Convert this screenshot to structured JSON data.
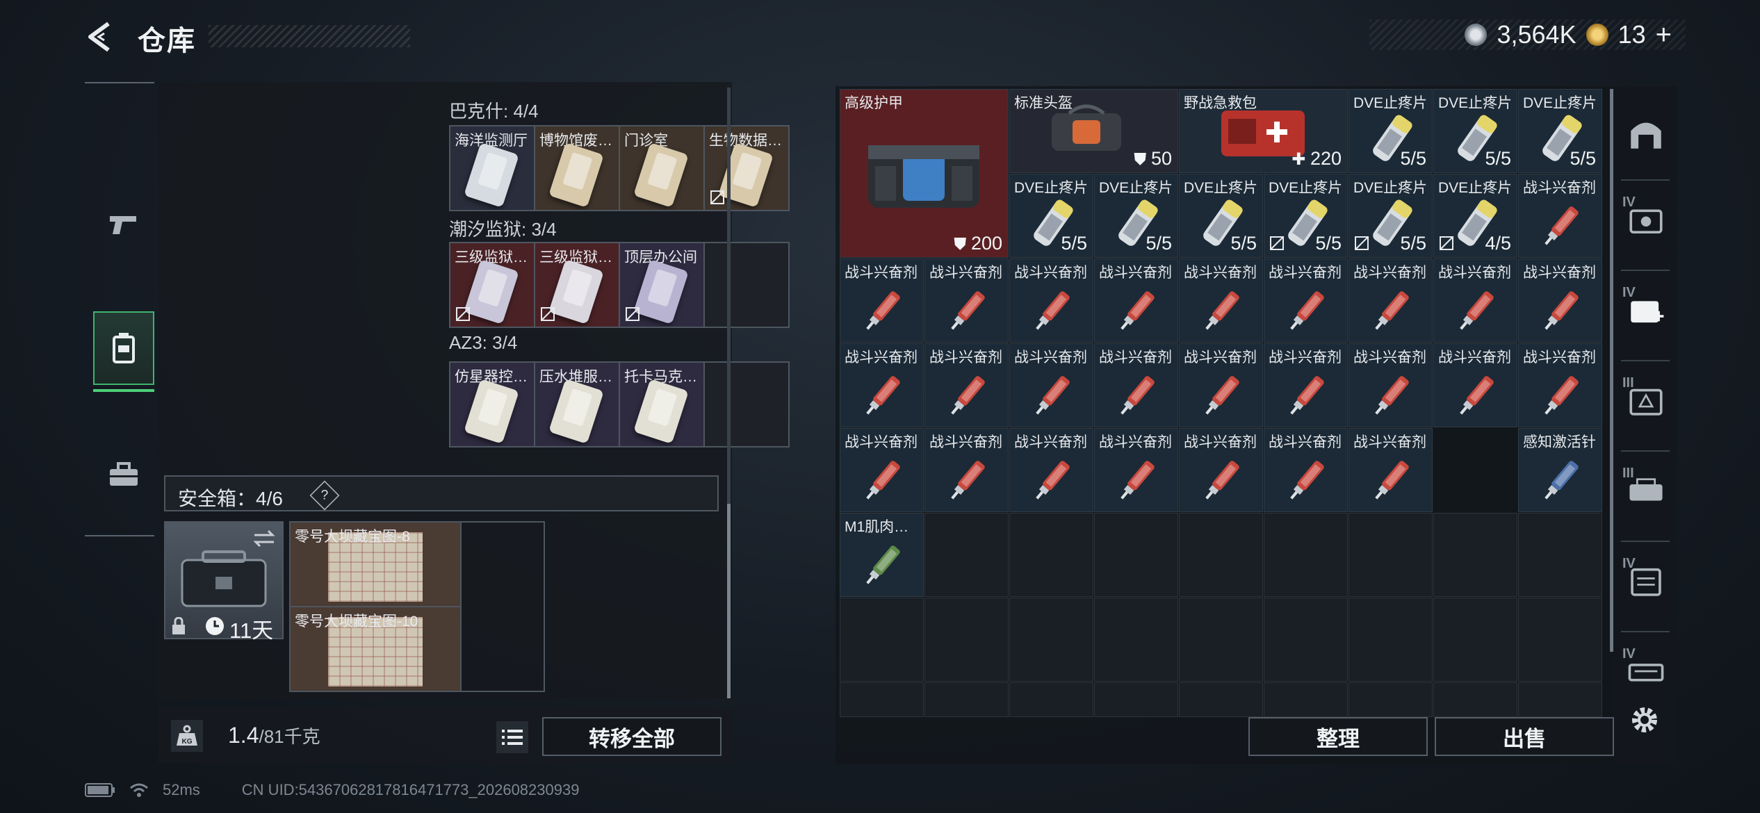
{
  "header": {
    "title": "仓库",
    "currency": [
      {
        "icon": "silver-coin-icon",
        "value": "3,564K"
      },
      {
        "icon": "gold-coin-icon",
        "value": "13"
      }
    ]
  },
  "left_nav": [
    {
      "icon": "pistol-icon"
    },
    {
      "icon": "backpack-icon"
    },
    {
      "icon": "vest-icon",
      "active": true
    },
    {
      "icon": "toolbox-icon"
    }
  ],
  "collections": [
    {
      "header": "巴克什: 4/4",
      "items": [
        {
          "label": "海洋监测厅",
          "tone": "#cfd6de"
        },
        {
          "label": "博物馆废…",
          "tone": "#d8c9ab"
        },
        {
          "label": "门诊室",
          "tone": "#d8c9ab"
        },
        {
          "label": "生物数据…",
          "tone": "#d8c9ab",
          "locked": true
        }
      ]
    },
    {
      "header": "潮汐监狱: 3/4",
      "items": [
        {
          "label": "三级监狱…",
          "tone": "#8f5aa0",
          "locked": true
        },
        {
          "label": "三级监狱…",
          "tone": "#b04a4a",
          "locked": true
        },
        {
          "label": "顶层办公间",
          "tone": "#a9a2c8",
          "locked": true
        }
      ]
    },
    {
      "header": "AZ3: 3/4",
      "items": [
        {
          "label": "仿星器控…",
          "tone": "#d8d3b0"
        },
        {
          "label": "压水堆服…",
          "tone": "#d8d3b0"
        },
        {
          "label": "托卡马克…",
          "tone": "#d8d3b0"
        }
      ]
    }
  ],
  "safe_box": {
    "label": "安全箱：4/6",
    "help": "?",
    "timer": "11天",
    "maps": [
      "零号大坝藏宝图-8",
      "零号大坝藏宝图-10"
    ]
  },
  "weight": {
    "current": "1.4",
    "max": "/81千克"
  },
  "buttons": {
    "transfer_all": "转移全部",
    "sort": "整理",
    "sell": "出售"
  },
  "stash": {
    "armor": {
      "label": "高级护甲",
      "durability": "200"
    },
    "helmet": {
      "label": "标准头盔",
      "durability": "50"
    },
    "medkit": {
      "label": "野战急救包",
      "charge": "220"
    },
    "pills": [
      {
        "label": "DVE止疼片",
        "count": "5/5"
      },
      {
        "label": "DVE止疼片",
        "count": "5/5"
      },
      {
        "label": "DVE止疼片",
        "count": "5/5"
      },
      {
        "label": "DVE止疼片",
        "count": "5/5"
      },
      {
        "label": "DVE止疼片",
        "count": "5/5"
      },
      {
        "label": "DVE止疼片",
        "count": "5/5"
      },
      {
        "label": "DVE止疼片",
        "count": "5/5",
        "locked": true
      },
      {
        "label": "DVE止疼片",
        "count": "5/5",
        "locked": true
      },
      {
        "label": "DVE止疼片",
        "count": "4/5",
        "locked": true
      }
    ],
    "stim_label": "战斗兴奋剂",
    "stim_count": 26,
    "sensor_label": "感知激活针",
    "m1_label": "M1肌肉…"
  },
  "right_nav": [
    {
      "icon": "arch-icon",
      "tier": ""
    },
    {
      "icon": "hardware-case-icon",
      "tier": "IV"
    },
    {
      "icon": "medical-case-icon",
      "tier": "IV"
    },
    {
      "icon": "electronics-case-icon",
      "tier": "III"
    },
    {
      "icon": "weapon-case-icon",
      "tier": "III"
    },
    {
      "icon": "document-case-icon",
      "tier": "IV"
    },
    {
      "icon": "ammo-case-icon",
      "tier": "IV"
    }
  ],
  "status": {
    "ping": "52ms",
    "uid": "CN UID:543670628178164717​73_202608230939"
  },
  "colors": {
    "accent": "#4ed07a",
    "armor_bg": "#5a1f22",
    "cell_bg": "#1b2a36"
  }
}
